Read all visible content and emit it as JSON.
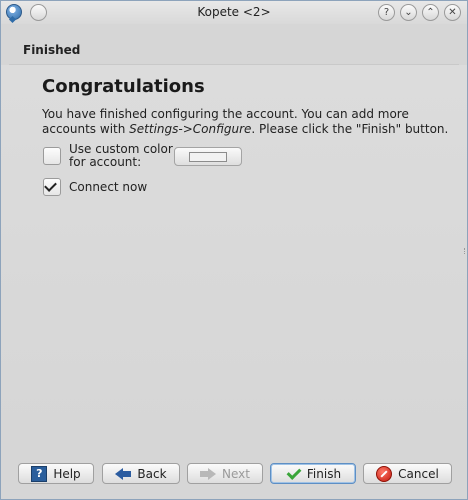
{
  "window": {
    "title": "Kopete <2>",
    "controls": [
      "?",
      "⌄",
      "⌃",
      "✕"
    ]
  },
  "page": {
    "header": "Finished",
    "heading": "Congratulations",
    "description_line1": "You have finished configuring the account. You can add more accounts with",
    "description_menu": "Settings->Configure",
    "description_rest": ". Please click the \"Finish\" button."
  },
  "options": {
    "custom_color": {
      "label_line1": "Use custom color",
      "label_line2": "for account:",
      "checked": false
    },
    "connect_now": {
      "label": "Connect now",
      "checked": true
    }
  },
  "buttons": {
    "help": "Help",
    "back": "Back",
    "next": "Next",
    "finish": "Finish",
    "cancel": "Cancel"
  },
  "icons": {
    "app": "kopete-icon",
    "help": "help-icon",
    "back": "arrow-left-icon",
    "next": "arrow-right-icon",
    "finish": "checkmark-icon",
    "cancel": "cancel-icon"
  }
}
